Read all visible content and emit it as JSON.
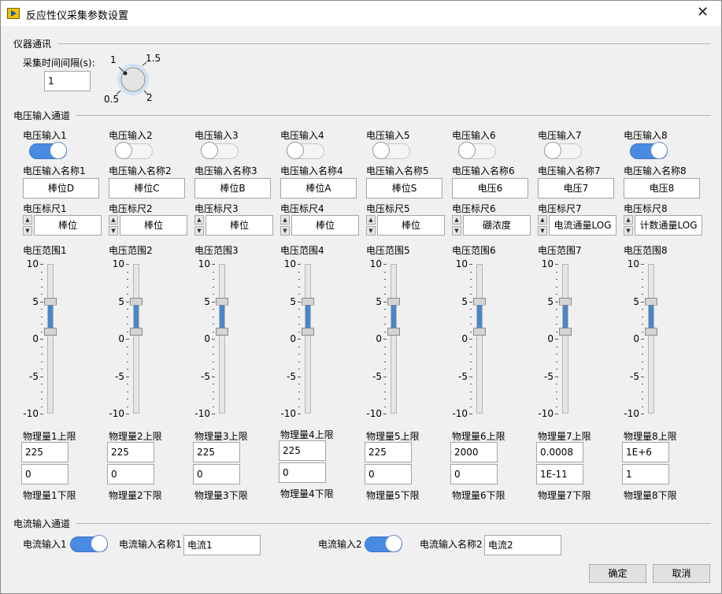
{
  "window": {
    "title": "反应性仪采集参数设置",
    "close_glyph": "✕"
  },
  "instrument": {
    "section": "仪器通讯",
    "interval_label": "采集时间间隔(s):",
    "interval_value": "1",
    "knob_labels": [
      "1",
      "1.5",
      "0.5",
      "2"
    ]
  },
  "voltage": {
    "section": "电压输入通道",
    "scale_ticks": [
      "10",
      "5",
      "0",
      "-5",
      "-10"
    ],
    "channels": [
      {
        "input_label": "电压输入1",
        "on": true,
        "name_label": "电压输入名称1",
        "name": "棒位D",
        "scale_label": "电压标尺1",
        "scale": "棒位",
        "range_label": "电压范围1",
        "range_low": 1,
        "range_high": 5,
        "upper_label": "物理量1上限",
        "upper": "225",
        "lower": "0",
        "lower_label": "物理量1下限"
      },
      {
        "input_label": "电压输入2",
        "on": false,
        "name_label": "电压输入名称2",
        "name": "棒位C",
        "scale_label": "电压标尺2",
        "scale": "棒位",
        "range_label": "电压范围2",
        "range_low": 1,
        "range_high": 5,
        "upper_label": "物理量2上限",
        "upper": "225",
        "lower": "0",
        "lower_label": "物理量2下限"
      },
      {
        "input_label": "电压输入3",
        "on": false,
        "name_label": "电压输入名称3",
        "name": "棒位B",
        "scale_label": "电压标尺3",
        "scale": "棒位",
        "range_label": "电压范围3",
        "range_low": 1,
        "range_high": 5,
        "upper_label": "物理量3上限",
        "upper": "225",
        "lower": "0",
        "lower_label": "物理量3下限"
      },
      {
        "input_label": "电压输入4",
        "on": false,
        "name_label": "电压输入名称4",
        "name": "棒位A",
        "scale_label": "电压标尺4",
        "scale": "棒位",
        "range_label": "电压范围4",
        "range_low": 1,
        "range_high": 5,
        "upper_label": "物理量4上限",
        "upper": "225",
        "lower": "0",
        "lower_label": "物理量4下限"
      },
      {
        "input_label": "电压输入5",
        "on": false,
        "name_label": "电压输入名称5",
        "name": "棒位S",
        "scale_label": "电压标尺5",
        "scale": "棒位",
        "range_label": "电压范围5",
        "range_low": 1,
        "range_high": 5,
        "upper_label": "物理量5上限",
        "upper": "225",
        "lower": "0",
        "lower_label": "物理量5下限"
      },
      {
        "input_label": "电压输入6",
        "on": false,
        "name_label": "电压输入名称6",
        "name": "电压6",
        "scale_label": "电压标尺6",
        "scale": "硼浓度",
        "range_label": "电压范围6",
        "range_low": 1,
        "range_high": 5,
        "upper_label": "物理量6上限",
        "upper": "2000",
        "lower": "0",
        "lower_label": "物理量6下限"
      },
      {
        "input_label": "电压输入7",
        "on": false,
        "name_label": "电压输入名称7",
        "name": "电压7",
        "scale_label": "电压标尺7",
        "scale": "电流通量LOG",
        "range_label": "电压范围7",
        "range_low": 1,
        "range_high": 5,
        "upper_label": "物理量7上限",
        "upper": "0.0008",
        "lower": "1E-11",
        "lower_label": "物理量7下限"
      },
      {
        "input_label": "电压输入8",
        "on": true,
        "name_label": "电压输入名称8",
        "name": "电压8",
        "scale_label": "电压标尺8",
        "scale": "计数通量LOG",
        "range_label": "电压范围8",
        "range_low": 1,
        "range_high": 5,
        "upper_label": "物理量8上限",
        "upper": "1E+6",
        "lower": "1",
        "lower_label": "物理量8下限"
      }
    ]
  },
  "current": {
    "section": "电流输入通道",
    "channels": [
      {
        "input_label": "电流输入1",
        "on": true,
        "name_label": "电流输入名称1",
        "name": "电流1"
      },
      {
        "input_label": "电流输入2",
        "on": true,
        "name_label": "电流输入名称2",
        "name": "电流2"
      }
    ]
  },
  "buttons": {
    "ok": "确定",
    "cancel": "取消"
  }
}
